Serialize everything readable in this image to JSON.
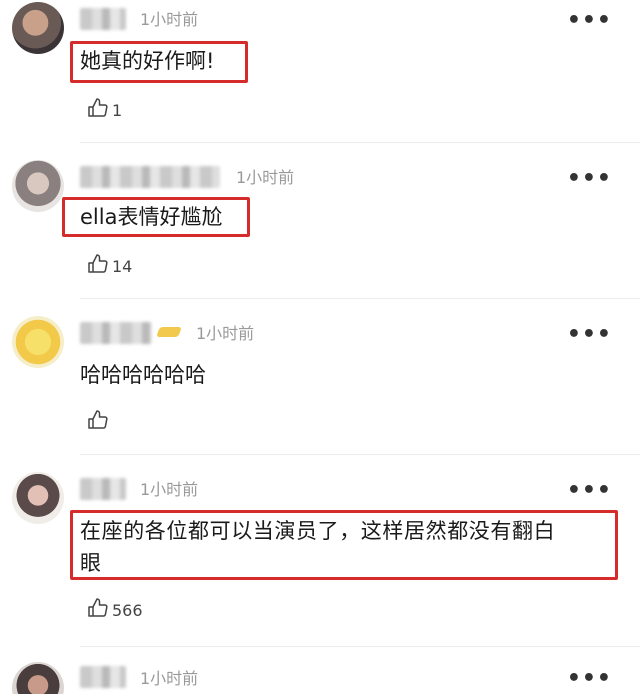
{
  "comments": [
    {
      "time": "1小时前",
      "text": "她真的好作啊!",
      "likes": "1"
    },
    {
      "time": "1小时前",
      "text": "ella表情好尴尬",
      "likes": "14"
    },
    {
      "time": "1小时前",
      "text": "哈哈哈哈哈哈",
      "likes": ""
    },
    {
      "time": "1小时前",
      "text_line1": "在座的各位都可以当演员了，这样居然都没有翻白",
      "text_line2": "眼",
      "likes": "566"
    },
    {
      "time": "1小时前"
    }
  ],
  "icons": {
    "more": "more-dots-icon",
    "like": "thumbs-up-icon"
  },
  "colors": {
    "highlight": "#d62b2b",
    "time": "#9a9a9a",
    "badge": "#f2c94c"
  },
  "more_glyph": "•••"
}
